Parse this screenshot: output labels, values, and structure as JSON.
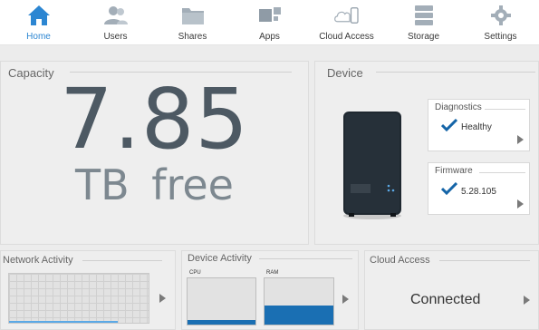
{
  "nav": {
    "items": [
      {
        "label": "Home",
        "icon": "home-icon",
        "active": true
      },
      {
        "label": "Users",
        "icon": "users-icon",
        "active": false
      },
      {
        "label": "Shares",
        "icon": "folder-icon",
        "active": false
      },
      {
        "label": "Apps",
        "icon": "apps-icon",
        "active": false
      },
      {
        "label": "Cloud Access",
        "icon": "cloud-device-icon",
        "active": false
      },
      {
        "label": "Storage",
        "icon": "storage-icon",
        "active": false
      },
      {
        "label": "Settings",
        "icon": "gear-icon",
        "active": false
      }
    ]
  },
  "capacity": {
    "title": "Capacity",
    "value": "7.85",
    "unit": "TB  free"
  },
  "device": {
    "title": "Device",
    "diagnostics": {
      "title": "Diagnostics",
      "value": "Healthy"
    },
    "firmware": {
      "title": "Firmware",
      "value": "5.28.105"
    }
  },
  "network_activity": {
    "title": "Network Activity"
  },
  "device_activity": {
    "title": "Device Activity",
    "cpu": {
      "label": "CPU",
      "usage_fraction": 0.1
    },
    "ram": {
      "label": "RAM",
      "usage_fraction": 0.42
    }
  },
  "cloud_access": {
    "title": "Cloud Access",
    "status": "Connected"
  },
  "colors": {
    "accent": "#2c86d2",
    "fill": "#1a6fb3",
    "check": "#1565a8"
  }
}
